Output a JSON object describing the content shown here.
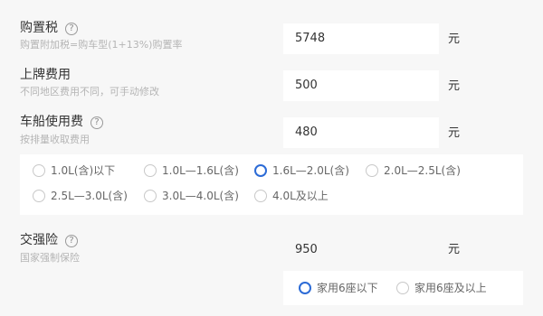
{
  "fields": {
    "purchase_tax": {
      "label": "购置税",
      "hint": "购置附加税=购车型(1+13%)购置率",
      "value": "5748",
      "unit": "元",
      "help": "?"
    },
    "plate_fee": {
      "label": "上牌费用",
      "hint": "不同地区费用不同，可手动修改",
      "value": "500",
      "unit": "元"
    },
    "vessel_tax": {
      "label": "车船使用费",
      "hint": "按排量收取费用",
      "value": "480",
      "unit": "元",
      "help": "?",
      "options": [
        {
          "label": "1.0L(含)以下",
          "selected": false
        },
        {
          "label": "1.0L—1.6L(含)",
          "selected": false
        },
        {
          "label": "1.6L—2.0L(含)",
          "selected": true
        },
        {
          "label": "2.0L—2.5L(含)",
          "selected": false
        },
        {
          "label": "2.5L—3.0L(含)",
          "selected": false
        },
        {
          "label": "3.0L—4.0L(含)",
          "selected": false
        },
        {
          "label": "4.0L及以上",
          "selected": false
        }
      ]
    },
    "compulsory_insurance": {
      "label": "交强险",
      "hint": "国家强制保险",
      "value": "950",
      "unit": "元",
      "help": "?",
      "options": [
        {
          "label": "家用6座以下",
          "selected": true
        },
        {
          "label": "家用6座及以上",
          "selected": false
        }
      ]
    }
  },
  "colors": {
    "accent": "#2c6bd6",
    "background": "#f7f7f7",
    "hint": "#b5b5b5"
  }
}
